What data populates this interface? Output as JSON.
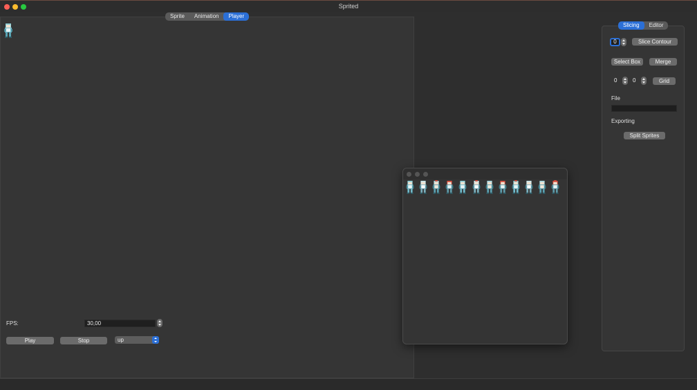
{
  "window": {
    "title": "Sprited"
  },
  "tabs": [
    {
      "label": "Sprite",
      "active": false
    },
    {
      "label": "Animation",
      "active": false
    },
    {
      "label": "Player",
      "active": true
    }
  ],
  "player": {
    "fps_label": "FPS:",
    "fps_value": "30,00",
    "play_label": "Play",
    "stop_label": "Stop",
    "direction_selected": "up"
  },
  "right_panel": {
    "tabs": [
      {
        "label": "Slicing",
        "active": true
      },
      {
        "label": "Editor",
        "active": false
      }
    ],
    "contour_value": "0",
    "slice_contour_label": "Slice Contour",
    "select_box_label": "Select Box",
    "merge_label": "Merge",
    "grid_x_value": "0",
    "grid_y_value": "0",
    "grid_label": "Grid",
    "file_heading": "File",
    "file_path": "",
    "exporting_heading": "Exporting",
    "split_sprites_label": "Split Sprites"
  },
  "sprite_sheet": {
    "frame_count": 12
  },
  "colors": {
    "accent": "#2b6fd6",
    "background": "#2e2e2e",
    "panel": "#353535"
  }
}
